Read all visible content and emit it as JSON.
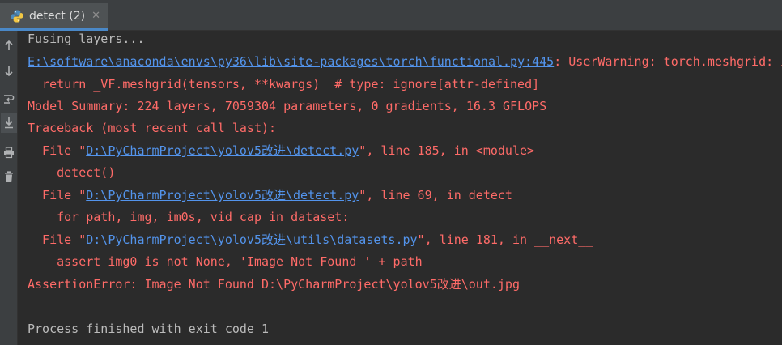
{
  "tab": {
    "title": "detect (2)",
    "close_glyph": "✕",
    "icon": "python-icon"
  },
  "gutter": {
    "icons": [
      "rerun-up-icon",
      "arrow-down-icon",
      "soft-wrap-icon",
      "scroll-to-end-icon",
      "print-icon",
      "trash-icon"
    ]
  },
  "console": {
    "l1": "Fusing layers...",
    "l2_link": "E:\\software\\anaconda\\envs\\py36\\lib\\site-packages\\torch\\functional.py:445",
    "l2_text": ": UserWarning: torch.meshgrid: in an upcoming release, it will be required to pass the indexing argument.",
    "l3": "  return _VF.meshgrid(tensors, **kwargs)  # type: ignore[attr-defined]",
    "l4": "Model Summary: 224 layers, 7059304 parameters, 0 gradients, 16.3 GFLOPS",
    "l5": "Traceback (most recent call last):",
    "l6_pre": "  File \"",
    "l6_link": "D:\\PyCharmProject\\yolov5改进\\detect.py",
    "l6_post": "\", line 185, in <module>",
    "l7": "    detect()",
    "l8_pre": "  File \"",
    "l8_link": "D:\\PyCharmProject\\yolov5改进\\detect.py",
    "l8_post": "\", line 69, in detect",
    "l9": "    for path, img, im0s, vid_cap in dataset:",
    "l10_pre": "  File \"",
    "l10_link": "D:\\PyCharmProject\\yolov5改进\\utils\\datasets.py",
    "l10_post": "\", line 181, in __next__",
    "l11": "    assert img0 is not None, 'Image Not Found ' + path",
    "l12": "AssertionError: Image Not Found D:\\PyCharmProject\\yolov5改进\\out.jpg",
    "l13": "Process finished with exit code 1"
  },
  "colors": {
    "background": "#2b2b2b",
    "text": "#bbbbbb",
    "error": "#ff6b68",
    "link": "#5394ec",
    "tab_accent": "#4a88c7"
  }
}
